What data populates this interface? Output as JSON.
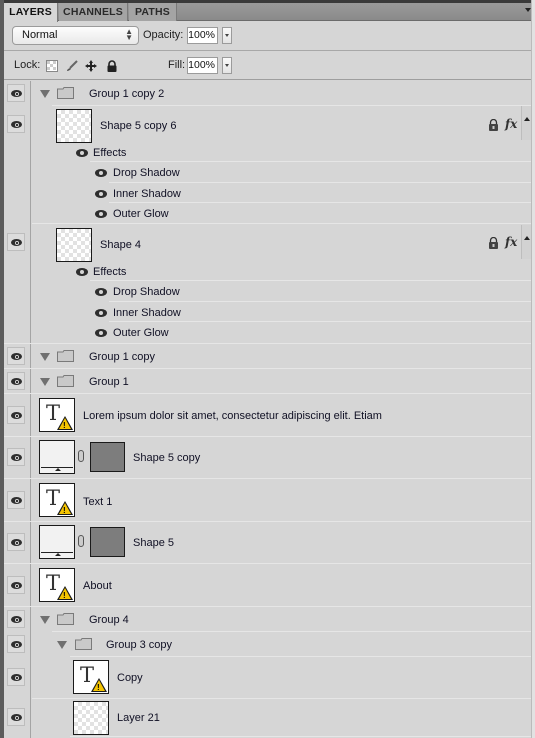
{
  "tabs": [
    {
      "label": "LAYERS",
      "active": true
    },
    {
      "label": "CHANNELS",
      "active": false
    },
    {
      "label": "PATHS",
      "active": false
    }
  ],
  "options": {
    "blend_mode": "Normal",
    "opacity_label": "Opacity:",
    "opacity_value": "100%",
    "lock_label": "Lock:",
    "fill_label": "Fill:",
    "fill_value": "100%"
  },
  "layers": [
    {
      "name": "Group 1 copy 2",
      "type": "group"
    },
    {
      "name": "Shape 5 copy 6",
      "type": "shape-transparent",
      "fx": "fx",
      "effects_label": "Effects",
      "effects": [
        "Drop Shadow",
        "Inner Shadow",
        "Outer Glow"
      ]
    },
    {
      "name": "Shape 4",
      "type": "shape-transparent",
      "fx": "fx",
      "effects_label": "Effects",
      "effects": [
        "Drop Shadow",
        "Inner Shadow",
        "Outer Glow"
      ]
    },
    {
      "name": "Group 1 copy",
      "type": "group"
    },
    {
      "name": "Group 1",
      "type": "group"
    },
    {
      "name": "Lorem ipsum dolor sit amet, consectetur adipiscing elit. Etiam",
      "type": "text"
    },
    {
      "name": "Shape 5 copy",
      "type": "shape-mask"
    },
    {
      "name": "Text 1",
      "type": "text"
    },
    {
      "name": "Shape 5",
      "type": "shape-mask"
    },
    {
      "name": "About",
      "type": "text"
    },
    {
      "name": "Group 4",
      "type": "group"
    },
    {
      "name": "Group 3 copy",
      "type": "group"
    },
    {
      "name": "Copy",
      "type": "text"
    },
    {
      "name": "Layer 21",
      "type": "shape-transparent"
    }
  ]
}
